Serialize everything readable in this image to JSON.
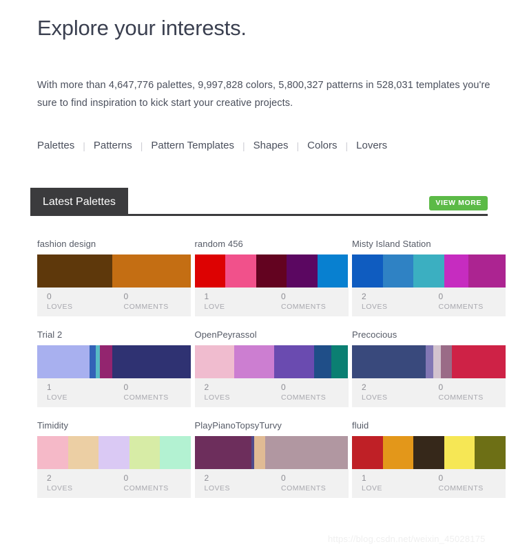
{
  "header": {
    "title": "Explore your interests.",
    "intro": "With more than 4,647,776 palettes, 9,997,828 colors, 5,800,327 patterns in 528,031 templates you're sure to find inspiration to kick start your creative projects."
  },
  "nav": {
    "separator": "|",
    "links": [
      {
        "label": "Palettes"
      },
      {
        "label": "Patterns"
      },
      {
        "label": "Pattern Templates"
      },
      {
        "label": "Shapes"
      },
      {
        "label": "Colors"
      },
      {
        "label": "Lovers"
      }
    ]
  },
  "section": {
    "tab_label": "Latest Palettes",
    "view_more_label": "VIEW MORE",
    "view_more_color": "#5cba47",
    "tab_bg_color": "#3b3b3d"
  },
  "palettes": [
    {
      "title": "fashion design",
      "loves_count": "0",
      "loves_label": "LOVES",
      "comments_count": "0",
      "comments_label": "COMMENTS",
      "colors": [
        {
          "hex": "#5e380b",
          "width": 49
        },
        {
          "hex": "#c46e13",
          "width": 51
        }
      ]
    },
    {
      "title": "random 456",
      "loves_count": "1",
      "loves_label": "LOVE",
      "comments_count": "0",
      "comments_label": "COMMENTS",
      "colors": [
        {
          "hex": "#dd0202",
          "width": 20
        },
        {
          "hex": "#f1518b",
          "width": 20
        },
        {
          "hex": "#630320",
          "width": 20
        },
        {
          "hex": "#5b0761",
          "width": 20
        },
        {
          "hex": "#0880d0",
          "width": 20
        }
      ]
    },
    {
      "title": "Misty Island Station",
      "loves_count": "2",
      "loves_label": "LOVES",
      "comments_count": "0",
      "comments_label": "COMMENTS",
      "colors": [
        {
          "hex": "#0f5cc0",
          "width": 20
        },
        {
          "hex": "#2f82c4",
          "width": 20
        },
        {
          "hex": "#3bafc1",
          "width": 20
        },
        {
          "hex": "#c62cc0",
          "width": 16
        },
        {
          "hex": "#ac2491",
          "width": 24
        }
      ]
    },
    {
      "title": "Trial 2",
      "loves_count": "1",
      "loves_label": "LOVE",
      "comments_count": "0",
      "comments_label": "COMMENTS",
      "colors": [
        {
          "hex": "#a8b0ef",
          "width": 34
        },
        {
          "hex": "#3362b7",
          "width": 4
        },
        {
          "hex": "#58bac4",
          "width": 3
        },
        {
          "hex": "#93256f",
          "width": 8
        },
        {
          "hex": "#2f3272",
          "width": 51
        }
      ]
    },
    {
      "title": "OpenPeyrassol",
      "loves_count": "2",
      "loves_label": "LOVES",
      "comments_count": "0",
      "comments_label": "COMMENTS",
      "colors": [
        {
          "hex": "#f0bccf",
          "width": 26
        },
        {
          "hex": "#cc7ed1",
          "width": 26
        },
        {
          "hex": "#6a4bb0",
          "width": 26
        },
        {
          "hex": "#1f4e88",
          "width": 11
        },
        {
          "hex": "#0b7f72",
          "width": 11
        }
      ]
    },
    {
      "title": "Precocious",
      "loves_count": "2",
      "loves_label": "LOVES",
      "comments_count": "0",
      "comments_label": "COMMENTS",
      "colors": [
        {
          "hex": "#39497c",
          "width": 48
        },
        {
          "hex": "#8277b4",
          "width": 5
        },
        {
          "hex": "#d3c3ce",
          "width": 5
        },
        {
          "hex": "#9a6b87",
          "width": 7
        },
        {
          "hex": "#ce2246",
          "width": 35
        }
      ]
    },
    {
      "title": "Timidity",
      "loves_count": "2",
      "loves_label": "LOVES",
      "comments_count": "0",
      "comments_label": "COMMENTS",
      "colors": [
        {
          "hex": "#f5b9c8",
          "width": 20
        },
        {
          "hex": "#eccfa4",
          "width": 20
        },
        {
          "hex": "#dac9f4",
          "width": 20
        },
        {
          "hex": "#d7eca6",
          "width": 20
        },
        {
          "hex": "#b3f2d2",
          "width": 20
        }
      ]
    },
    {
      "title": "PlayPianoTopsyTurvy",
      "loves_count": "2",
      "loves_label": "LOVES",
      "comments_count": "0",
      "comments_label": "COMMENTS",
      "colors": [
        {
          "hex": "#6d2e5c",
          "width": 37
        },
        {
          "hex": "#4f4a8b",
          "width": 2
        },
        {
          "hex": "#e0bb94",
          "width": 7
        },
        {
          "hex": "#b197a1",
          "width": 54
        }
      ]
    },
    {
      "title": "fluid",
      "loves_count": "1",
      "loves_label": "LOVE",
      "comments_count": "0",
      "comments_label": "COMMENTS",
      "colors": [
        {
          "hex": "#bf2026",
          "width": 20
        },
        {
          "hex": "#e3971a",
          "width": 20
        },
        {
          "hex": "#36281a",
          "width": 20
        },
        {
          "hex": "#f6e755",
          "width": 20
        },
        {
          "hex": "#6d6f15",
          "width": 20
        }
      ]
    }
  ],
  "watermark": "https://blog.csdn.net/weixin_45028175"
}
